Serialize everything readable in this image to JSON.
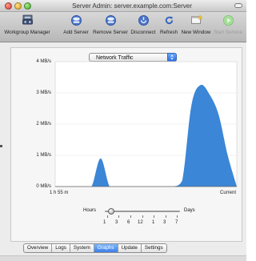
{
  "window": {
    "title": "Server Admin: server.example.com:Server"
  },
  "toolbar": {
    "items": [
      {
        "label": "Workgroup Manager",
        "icon": "workgroup-manager-icon",
        "enabled": true
      },
      {
        "label": "Add Server",
        "icon": "add-server-icon",
        "enabled": true
      },
      {
        "label": "Remove Server",
        "icon": "remove-server-icon",
        "enabled": true
      },
      {
        "label": "Disconnect",
        "icon": "disconnect-icon",
        "enabled": true
      },
      {
        "label": "Refresh",
        "icon": "refresh-icon",
        "enabled": true
      },
      {
        "label": "New Window",
        "icon": "new-window-icon",
        "enabled": true
      },
      {
        "label": "Start Service",
        "icon": "start-service-icon",
        "enabled": false
      }
    ]
  },
  "graph": {
    "selector": "Network Traffic",
    "y_ticks": [
      "4 MB/s",
      "3 MB/s",
      "2 MB/s",
      "1 MB/s",
      "0 MB/s"
    ],
    "x_start": "1 h 55 m",
    "x_end": "Current"
  },
  "chart_data": {
    "type": "area",
    "x": [
      0,
      5,
      10,
      15,
      20,
      25,
      30,
      35,
      40,
      45,
      50,
      55,
      60,
      65,
      70,
      75,
      80,
      85,
      90,
      95,
      100
    ],
    "series": [
      {
        "values": [
          0,
          0,
          0,
          0,
          0,
          0.9,
          0,
          0,
          0,
          0,
          0,
          0,
          0,
          0,
          0.2,
          2.6,
          3.25,
          2.95,
          2.3,
          1.0,
          0
        ]
      }
    ],
    "ylim": [
      0,
      4
    ],
    "color": "#3b86d6"
  },
  "slider": {
    "min_label": "Hours",
    "max_label": "Days",
    "tick_labels": [
      "1",
      "3",
      "6",
      "12",
      "1",
      "3",
      "7"
    ],
    "selected_index": 1
  },
  "tabs": [
    {
      "label": "Overview",
      "active": false
    },
    {
      "label": "Logs",
      "active": false
    },
    {
      "label": "System",
      "active": false
    },
    {
      "label": "Graphs",
      "active": true
    },
    {
      "label": "Update",
      "active": false
    },
    {
      "label": "Settings",
      "active": false
    }
  ]
}
